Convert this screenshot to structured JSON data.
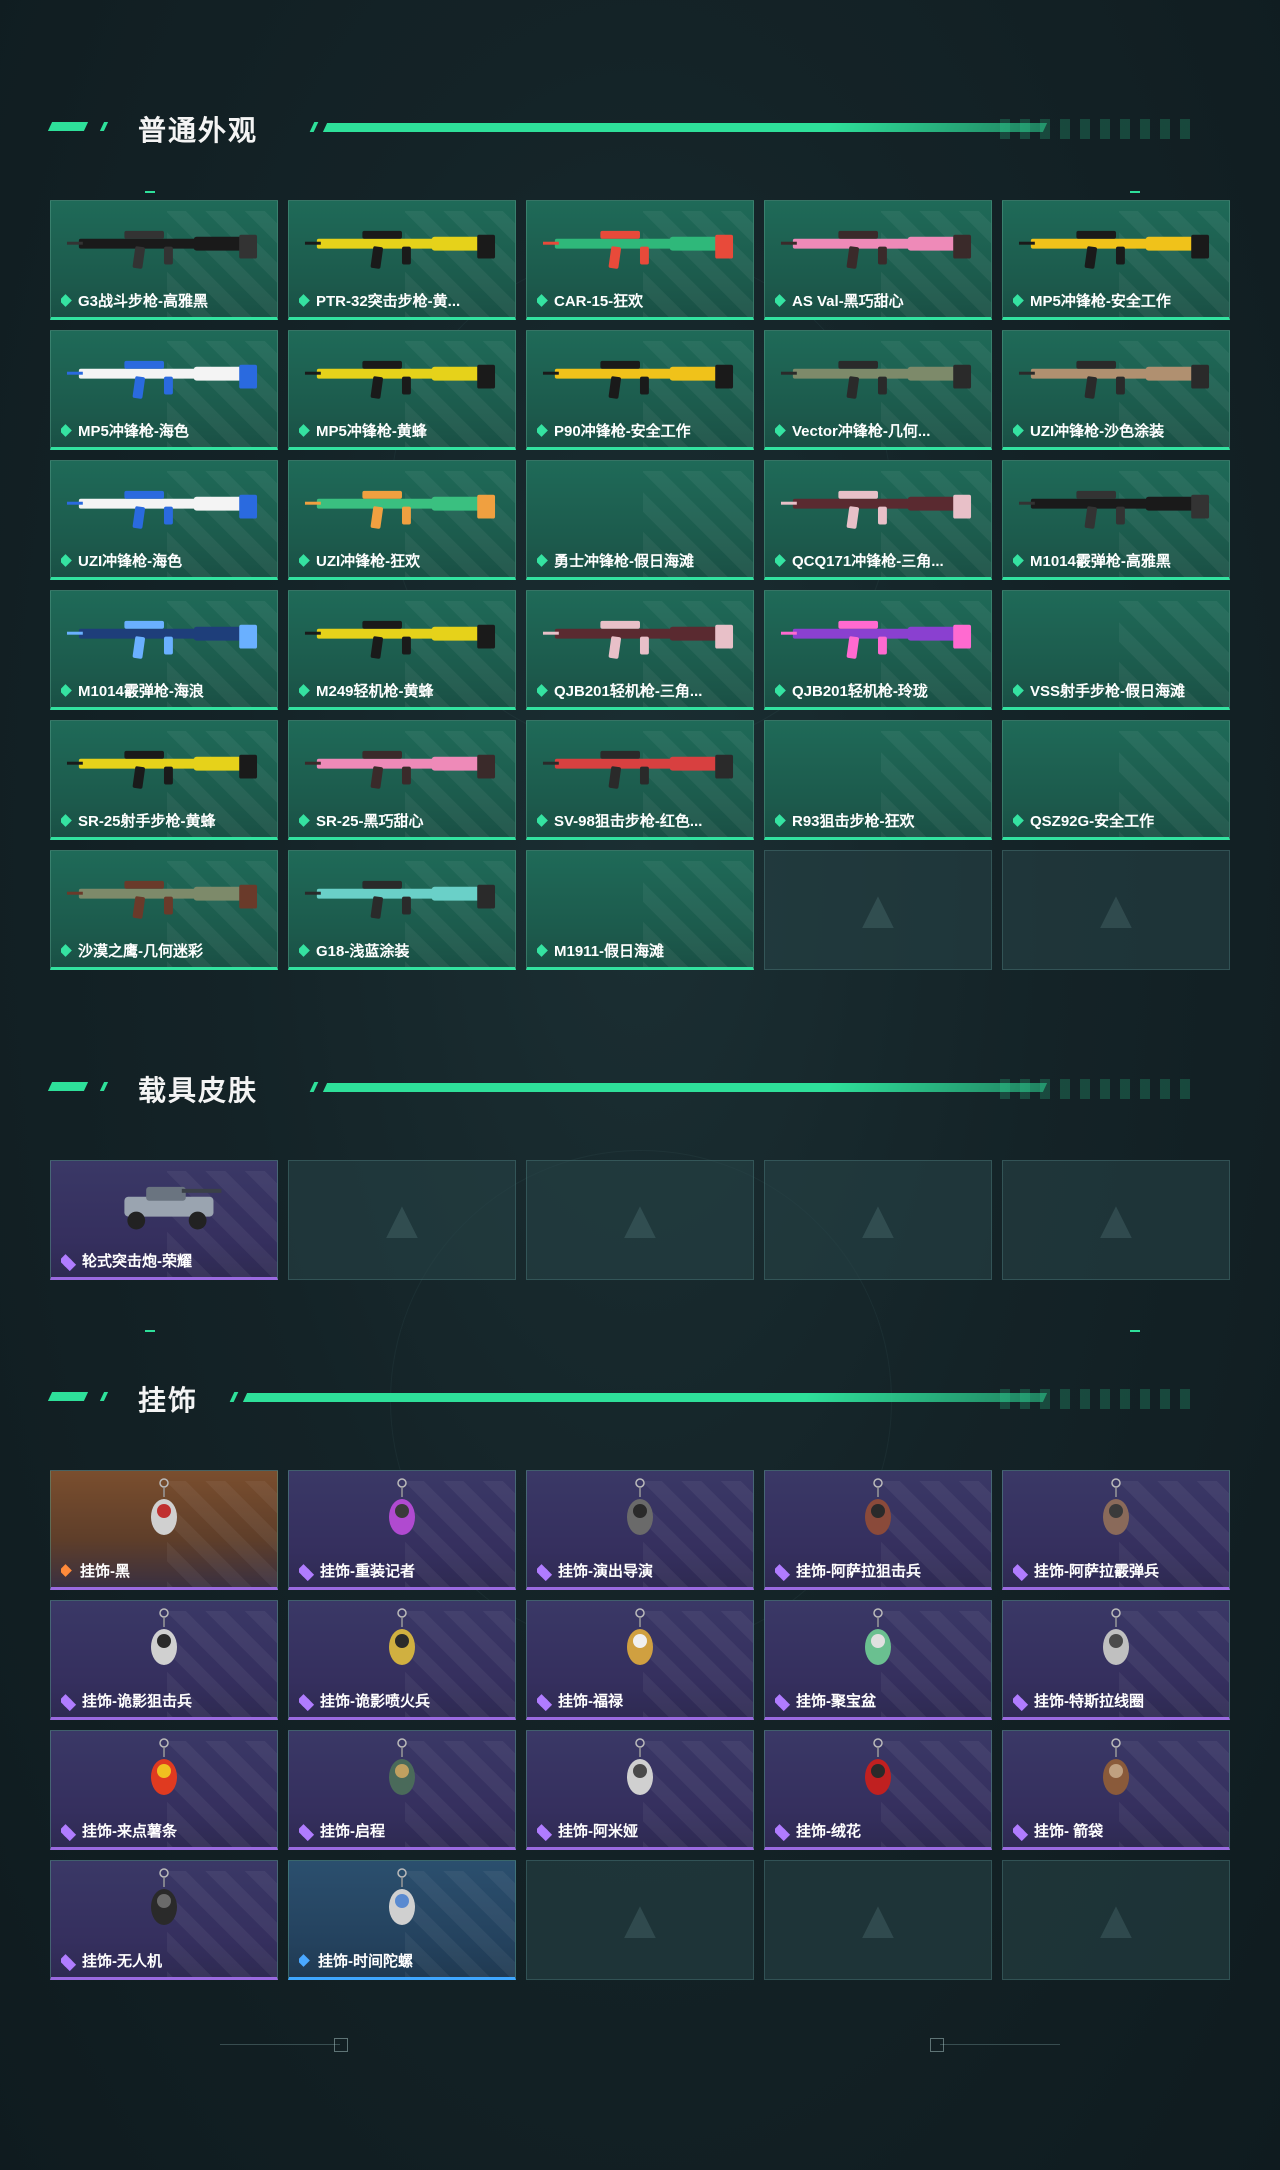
{
  "sections": {
    "weapons": {
      "title": "普通外观",
      "items": [
        {
          "name": "G3战斗步枪-高雅黑",
          "color": "#1a1a1a",
          "accent": "#333333"
        },
        {
          "name": "PTR-32突击步枪-黄...",
          "color": "#e6d21a",
          "accent": "#1a1a1a"
        },
        {
          "name": "CAR-15-狂欢",
          "color": "#2fb87a",
          "accent": "#e84a3a"
        },
        {
          "name": "AS Val-黑巧甜心",
          "color": "#ee8ab8",
          "accent": "#3a2a2a"
        },
        {
          "name": "MP5冲锋枪-安全工作",
          "color": "#f0c21a",
          "accent": "#1a1a1a"
        },
        {
          "name": "MP5冲锋枪-海色",
          "color": "#f4f4f4",
          "accent": "#2a6adf"
        },
        {
          "name": "MP5冲锋枪-黄蜂",
          "color": "#e6d21a",
          "accent": "#1a1a1a"
        },
        {
          "name": "P90冲锋枪-安全工作",
          "color": "#f0c21a",
          "accent": "#1a1a1a"
        },
        {
          "name": "Vector冲锋枪-几何...",
          "color": "#7d8a6a",
          "accent": "#2a2a2a"
        },
        {
          "name": "UZI冲锋枪-沙色涂装",
          "color": "#b09070",
          "accent": "#2a2a2a"
        },
        {
          "name": "UZI冲锋枪-海色",
          "color": "#f4f4f4",
          "accent": "#2a6adf"
        },
        {
          "name": "UZI冲锋枪-狂欢",
          "color": "#3ac080",
          "accent": "#f0a040"
        },
        {
          "name": "勇士冲锋枪-假日海滩",
          "color": "",
          "accent": ""
        },
        {
          "name": "QCQ171冲锋枪-三角...",
          "color": "#5a2a30",
          "accent": "#e8c0c8"
        },
        {
          "name": "M1014霰弹枪-高雅黑",
          "color": "#1a1a1a",
          "accent": "#333333"
        },
        {
          "name": "M1014霰弹枪-海浪",
          "color": "#1e3e7a",
          "accent": "#6ab0ff"
        },
        {
          "name": "M249轻机枪-黄蜂",
          "color": "#e6d21a",
          "accent": "#1a1a1a"
        },
        {
          "name": "QJB201轻机枪-三角...",
          "color": "#5a2a30",
          "accent": "#e8c0c8"
        },
        {
          "name": "QJB201轻机枪-玲珑",
          "color": "#8a40d0",
          "accent": "#ff6ad0"
        },
        {
          "name": "VSS射手步枪-假日海滩",
          "color": "",
          "accent": ""
        },
        {
          "name": "SR-25射手步枪-黄蜂",
          "color": "#e6d21a",
          "accent": "#1a1a1a"
        },
        {
          "name": "SR-25-黑巧甜心",
          "color": "#ee8ab8",
          "accent": "#3a2a2a"
        },
        {
          "name": "SV-98狙击步枪-红色...",
          "color": "#d84040",
          "accent": "#2a2a2a"
        },
        {
          "name": "R93狙击步枪-狂欢",
          "color": "",
          "accent": ""
        },
        {
          "name": "QSZ92G-安全工作",
          "color": "",
          "accent": ""
        },
        {
          "name": "沙漠之鹰-几何迷彩",
          "color": "#7d8a6a",
          "accent": "#6a3a2a"
        },
        {
          "name": "G18-浅蓝涂装",
          "color": "#6ad0c8",
          "accent": "#2a2a2a"
        },
        {
          "name": "M1911-假日海滩",
          "color": "",
          "accent": ""
        }
      ],
      "empty_slots": 2
    },
    "vehicles": {
      "title": "载具皮肤",
      "items": [
        {
          "name": "轮式突击炮-荣耀"
        }
      ],
      "empty_slots": 4
    },
    "charms": {
      "title": "挂饰",
      "items": [
        {
          "name": "挂饰-黑",
          "rarity": "orange"
        },
        {
          "name": "挂饰-重装记者",
          "rarity": "purple"
        },
        {
          "name": "挂饰-演出导演",
          "rarity": "purple"
        },
        {
          "name": "挂饰-阿萨拉狙击兵",
          "rarity": "purple"
        },
        {
          "name": "挂饰-阿萨拉霰弹兵",
          "rarity": "purple"
        },
        {
          "name": "挂饰-诡影狙击兵",
          "rarity": "purple"
        },
        {
          "name": "挂饰-诡影喷火兵",
          "rarity": "purple"
        },
        {
          "name": "挂饰-福禄",
          "rarity": "purple"
        },
        {
          "name": "挂饰-聚宝盆",
          "rarity": "purple"
        },
        {
          "name": "挂饰-特斯拉线圈",
          "rarity": "purple"
        },
        {
          "name": "挂饰-来点薯条",
          "rarity": "purple"
        },
        {
          "name": "挂饰-启程",
          "rarity": "purple"
        },
        {
          "name": "挂饰-阿米娅",
          "rarity": "purple"
        },
        {
          "name": "挂饰-绒花",
          "rarity": "purple"
        },
        {
          "name": "挂饰- 箭袋",
          "rarity": "purple"
        },
        {
          "name": "挂饰-无人机",
          "rarity": "purple"
        },
        {
          "name": "挂饰-时间陀螺",
          "rarity": "blue"
        }
      ],
      "empty_slots": 3
    }
  },
  "colors": {
    "accent_green": "#2ee09a",
    "rarity_purple": "#9a6ae0",
    "rarity_blue": "#3fa7ff",
    "rarity_orange": "#ff8a3a"
  }
}
